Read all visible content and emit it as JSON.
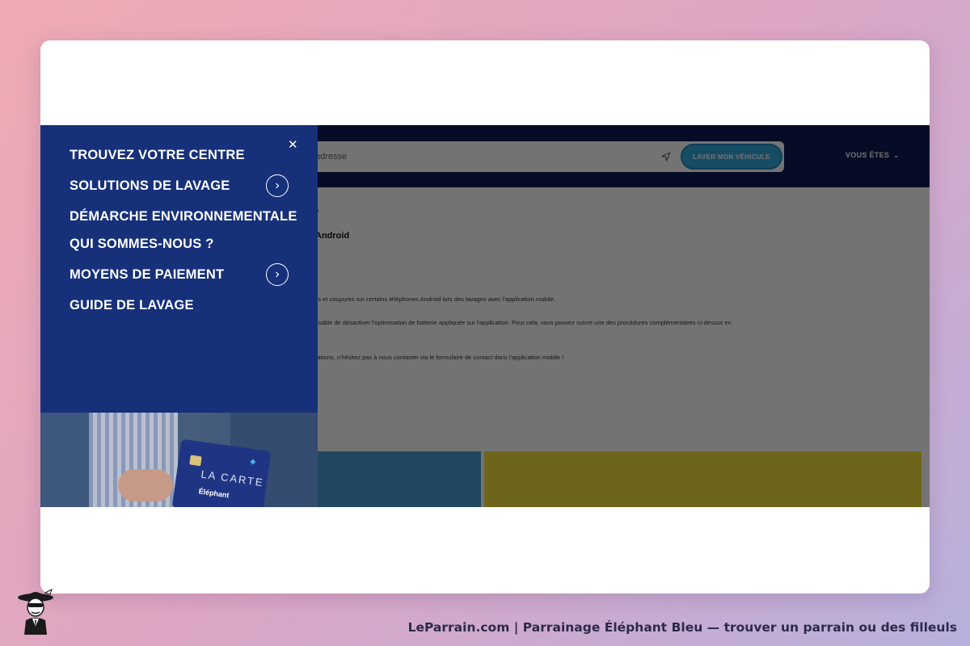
{
  "site": {
    "search_placeholder": "adresse",
    "cta_label": "LAVER MON VÉHICULE",
    "vous_etes_label": "VOUS ÊTES",
    "article_title": "Android",
    "paragraphs": [
      "ons et coupures sur certains téléphones Android lors des lavages avec l'application mobile.",
      "ensable de désactiver l'optimisation de batterie appliquée sur l'application. Pour cela, vous pouvez suivre une des procédures complémentaires ci-dessus en",
      "fications, n'hésitez pas à nous contacter via le formulaire de contact dans l'application mobile !"
    ]
  },
  "menu": {
    "items": [
      {
        "label": "TROUVEZ VOTRE CENTRE",
        "has_submenu": false
      },
      {
        "label": "SOLUTIONS DE LAVAGE",
        "has_submenu": true
      },
      {
        "label": "DÉMARCHE ENVIRONNEMENTALE",
        "has_submenu": false
      },
      {
        "label": "QUI SOMMES-NOUS ?",
        "has_submenu": false
      },
      {
        "label": "MOYENS DE PAIEMENT",
        "has_submenu": true
      },
      {
        "label": "GUIDE DE LAVAGE",
        "has_submenu": false
      }
    ],
    "promo": {
      "card_title": "LA CARTE",
      "card_brand": "Éléphant"
    }
  },
  "footer": {
    "text": "LeParrain.com | Parrainage Éléphant Bleu — trouver un parrain ou des filleuls"
  },
  "colors": {
    "menu_bg": "#16307a",
    "header_bg": "#0e1c55",
    "cta": "#34a9e0",
    "band_blue": "#4b9fd8",
    "band_yellow": "#f2e13a"
  },
  "icons": {
    "close": "close-icon",
    "submenu": "chevron-right-icon",
    "locate": "location-arrow-icon",
    "dropdown": "chevron-down-icon"
  }
}
